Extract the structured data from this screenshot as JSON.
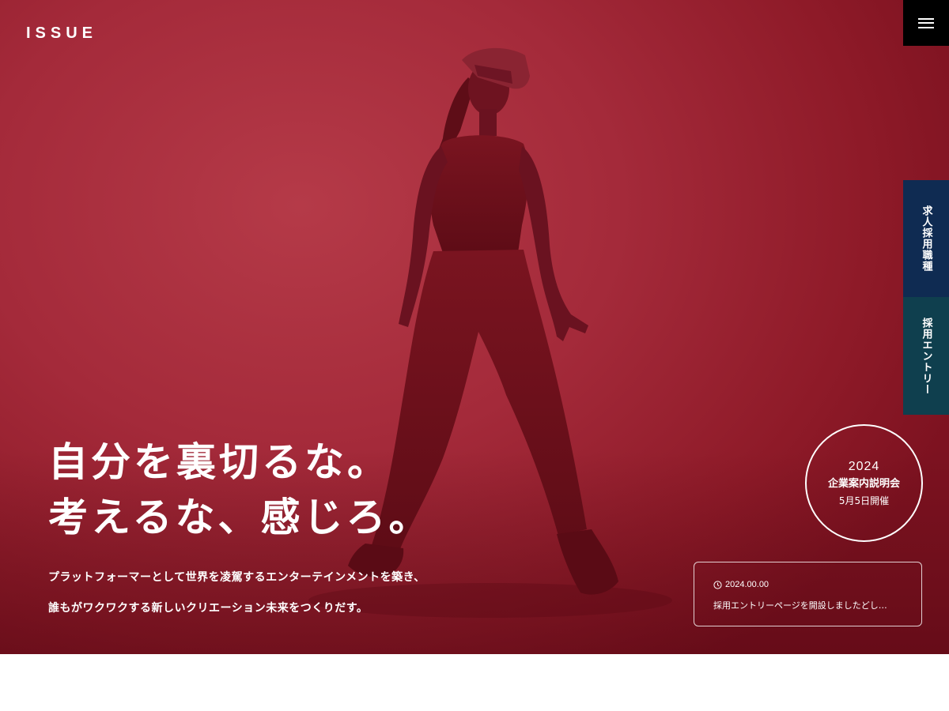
{
  "header": {
    "logo": "ISSUE",
    "menu_icon": "hamburger-menu-icon"
  },
  "side_tabs": {
    "jobs": "求人採用職種",
    "entry": "採用エントリー",
    "jobs_color": "#0f2b52",
    "entry_color": "#0f3f4e"
  },
  "hero": {
    "headline": [
      "自分を裏切るな。",
      "考えるな、感じろ。"
    ],
    "lead": [
      "プラットフォーマーとして世界を凌駕するエンターテインメントを築き、",
      "誰もがワクワクする新しいクリエーション未来をつくりだす。"
    ],
    "background_color": "#a42a3a"
  },
  "event": {
    "year": "2024",
    "title": "企業案内説明会",
    "date": "5月5日開催"
  },
  "news": {
    "icon": "clock-icon",
    "date": "2024.00.00",
    "title": "採用エントリーページを開設しましたどし…"
  }
}
